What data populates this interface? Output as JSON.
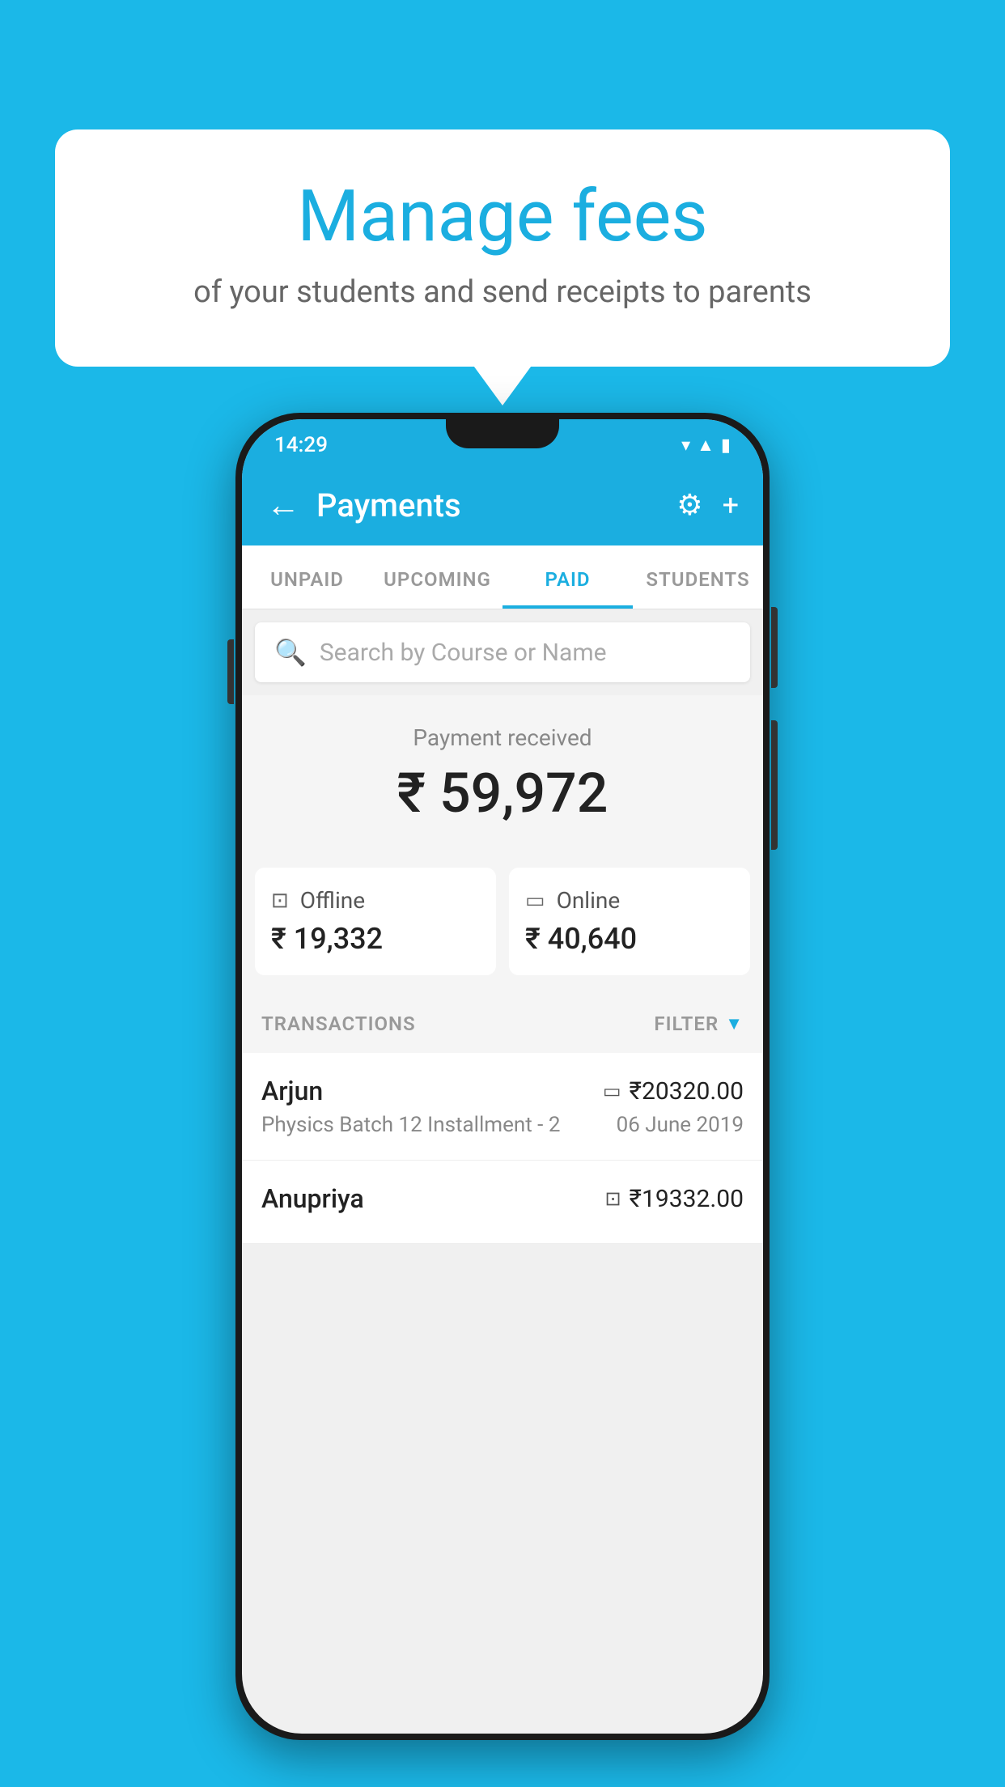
{
  "background_color": "#1bb8e8",
  "speech_bubble": {
    "title": "Manage fees",
    "subtitle": "of your students and send receipts to parents"
  },
  "status_bar": {
    "time": "14:29",
    "icons": [
      "wifi",
      "signal",
      "battery"
    ]
  },
  "app_bar": {
    "title": "Payments",
    "back_label": "←",
    "settings_label": "⚙",
    "add_label": "+"
  },
  "tabs": [
    {
      "label": "UNPAID",
      "active": false
    },
    {
      "label": "UPCOMING",
      "active": false
    },
    {
      "label": "PAID",
      "active": true
    },
    {
      "label": "STUDENTS",
      "active": false
    }
  ],
  "search": {
    "placeholder": "Search by Course or Name"
  },
  "payment_received": {
    "label": "Payment received",
    "amount": "₹ 59,972"
  },
  "payment_cards": [
    {
      "label": "Offline",
      "amount": "₹ 19,332",
      "icon": "offline"
    },
    {
      "label": "Online",
      "amount": "₹ 40,640",
      "icon": "online"
    }
  ],
  "transactions_section": {
    "label": "TRANSACTIONS",
    "filter_label": "FILTER"
  },
  "transactions": [
    {
      "name": "Arjun",
      "amount": "₹20320.00",
      "description": "Physics Batch 12 Installment - 2",
      "date": "06 June 2019",
      "payment_type": "online"
    },
    {
      "name": "Anupriya",
      "amount": "₹19332.00",
      "description": "",
      "date": "",
      "payment_type": "offline"
    }
  ]
}
